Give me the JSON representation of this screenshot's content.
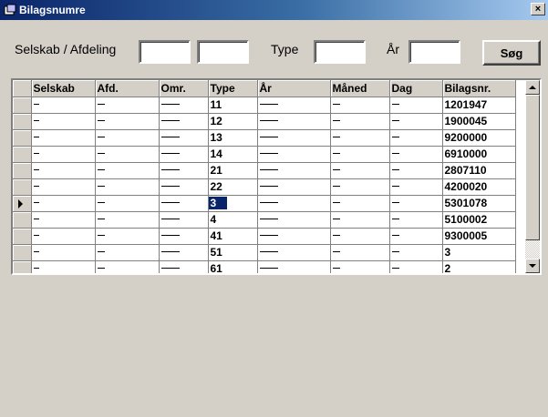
{
  "window": {
    "title": "Bilagsnumre",
    "close_label": "×"
  },
  "filters": {
    "company_label": "Selskab / Afdeling",
    "type_label": "Type",
    "year_label": "År",
    "company_value": "",
    "department_value": "",
    "type_value": "",
    "year_value": "",
    "search_label": "Søg"
  },
  "grid": {
    "columns": [
      "Selskab",
      "Afd.",
      "Omr.",
      "Type",
      "År",
      "Måned",
      "Dag",
      "Bilagsnr."
    ],
    "rows": [
      {
        "type": "11",
        "bilagsnr": "1201947"
      },
      {
        "type": "12",
        "bilagsnr": "1900045"
      },
      {
        "type": "13",
        "bilagsnr": "9200000"
      },
      {
        "type": "14",
        "bilagsnr": "6910000"
      },
      {
        "type": "21",
        "bilagsnr": "2807110"
      },
      {
        "type": "22",
        "bilagsnr": "4200020"
      },
      {
        "type": "3",
        "bilagsnr": "5301078"
      },
      {
        "type": "4",
        "bilagsnr": "5100002"
      },
      {
        "type": "41",
        "bilagsnr": "9300005"
      },
      {
        "type": "51",
        "bilagsnr": "3"
      },
      {
        "type": "61",
        "bilagsnr": "2"
      }
    ],
    "current_row_index": 6
  }
}
